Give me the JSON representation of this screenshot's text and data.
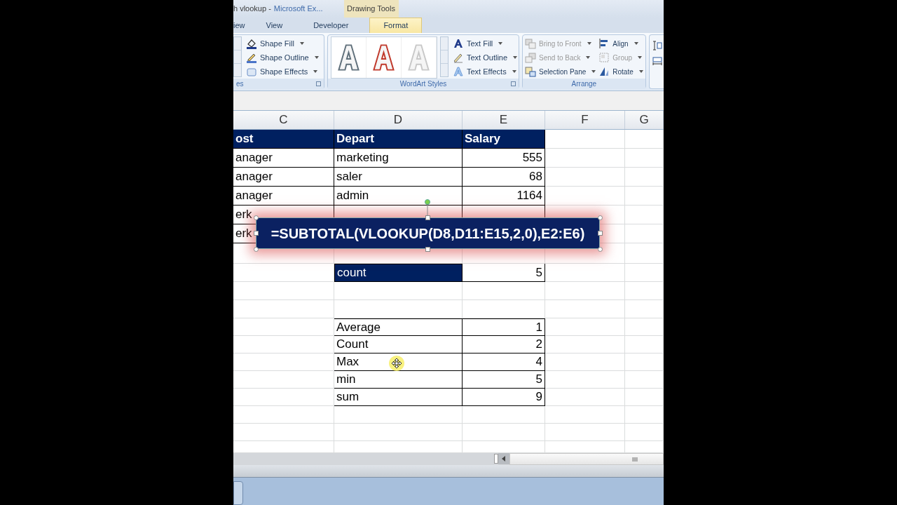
{
  "window": {
    "title": "h vlookup -",
    "app_name": "Microsoft Ex...",
    "context_tab_group": "Drawing Tools"
  },
  "tabs": [
    {
      "label": "iew",
      "selected": false
    },
    {
      "label": "View",
      "selected": false
    },
    {
      "label": "Developer",
      "selected": false
    },
    {
      "label": "Format",
      "selected": true
    }
  ],
  "ribbon": {
    "shape_styles": {
      "label": "es",
      "commands": [
        {
          "label": "Shape Fill",
          "kind": "fill"
        },
        {
          "label": "Shape Outline",
          "kind": "outline"
        },
        {
          "label": "Shape Effects",
          "kind": "effects"
        }
      ]
    },
    "wordart_styles": {
      "label": "WordArt Styles",
      "presets": [
        {
          "color": "#5f6f7a"
        },
        {
          "color": "#c0392b"
        },
        {
          "color": "#c8c8c8"
        }
      ],
      "commands": [
        {
          "label": "Text Fill",
          "kind": "fill"
        },
        {
          "label": "Text Outline",
          "kind": "outline"
        },
        {
          "label": "Text Effects",
          "kind": "effects"
        }
      ]
    },
    "arrange": {
      "label": "Arrange",
      "commands": [
        {
          "label": "Bring to Front",
          "disabled": true,
          "kind": "front"
        },
        {
          "label": "Send to Back",
          "disabled": true,
          "kind": "back"
        },
        {
          "label": "Selection Pane",
          "disabled": false,
          "kind": "pane"
        },
        {
          "label": "Align",
          "disabled": false,
          "kind": "align"
        },
        {
          "label": "Group",
          "disabled": true,
          "kind": "group"
        },
        {
          "label": "Rotate",
          "disabled": false,
          "kind": "rotate"
        }
      ]
    }
  },
  "columns": [
    "C",
    "D",
    "E",
    "F",
    "G"
  ],
  "table": {
    "header": [
      "ost",
      "Depart",
      "Salary"
    ],
    "rows": [
      {
        "column_c": "anager",
        "depart": "marketing",
        "salary": "555"
      },
      {
        "column_c": "anager",
        "depart": "saler",
        "salary": "68"
      },
      {
        "column_c": "anager",
        "depart": "admin",
        "salary": "1164"
      },
      {
        "column_c": "erk"
      },
      {
        "column_c": "erk"
      }
    ]
  },
  "text_box": {
    "text": "=SUBTOTAL(VLOOKUP(D8,D11:E15,2,0),E2:E6)"
  },
  "count_row": {
    "label": "count",
    "value": "5"
  },
  "function_table": [
    {
      "name": "Average",
      "number": "1"
    },
    {
      "name": "Count",
      "number": "2"
    },
    {
      "name": "Max",
      "number": "4"
    },
    {
      "name": "min",
      "number": "5"
    },
    {
      "name": "sum",
      "number": "9"
    }
  ]
}
